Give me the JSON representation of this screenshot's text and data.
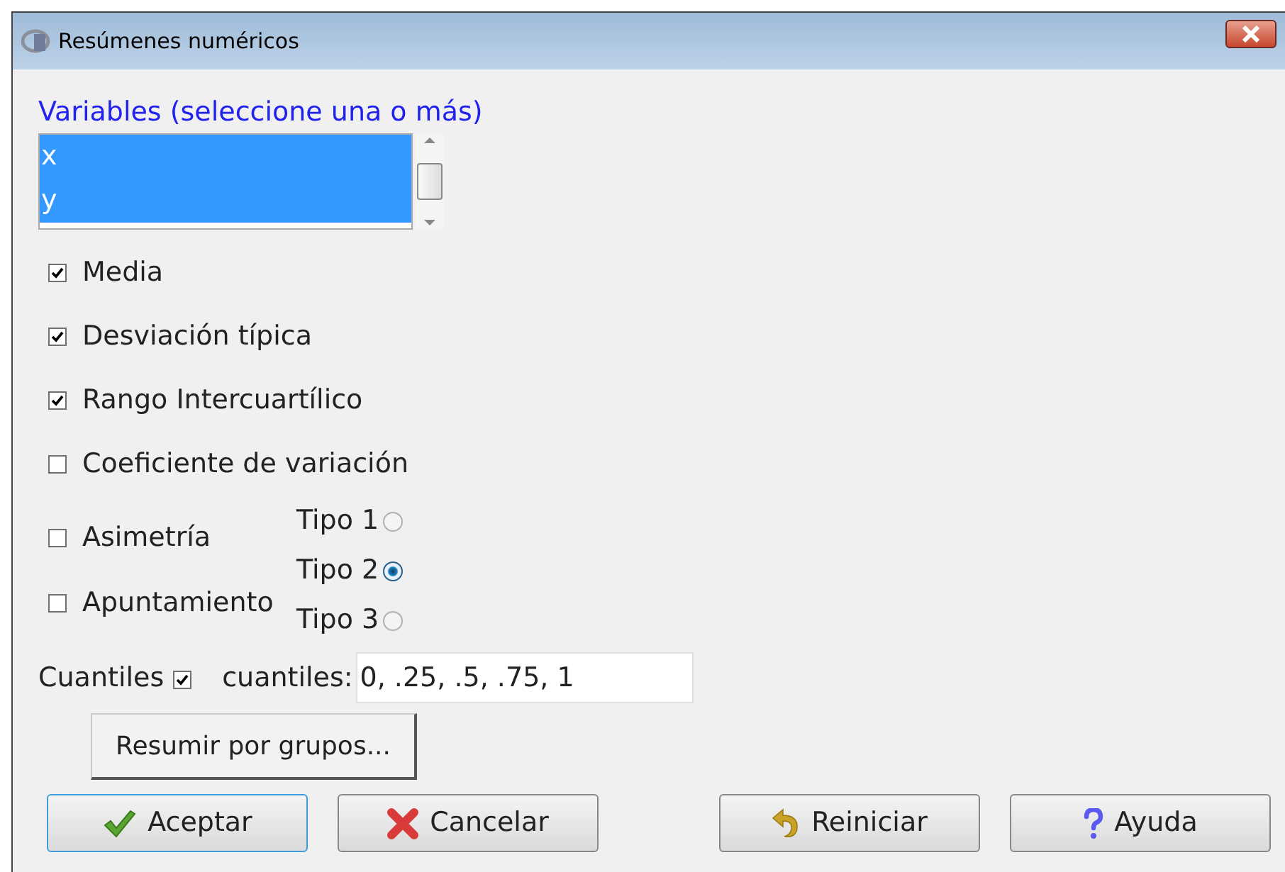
{
  "window": {
    "title": "Resúmenes numéricos"
  },
  "variables": {
    "label": "Variables (seleccione una o más)",
    "items": [
      {
        "text": "x",
        "selected": true
      },
      {
        "text": "y",
        "selected": true
      }
    ]
  },
  "statistics": [
    {
      "label": "Media",
      "checked": true
    },
    {
      "label": "Desviación típica",
      "checked": true
    },
    {
      "label": "Rango Intercuartílico",
      "checked": true
    },
    {
      "label": "Coeficiente de variación",
      "checked": false
    }
  ],
  "shape_statistics": [
    {
      "label": "Asimetría",
      "checked": false
    },
    {
      "label": "Apuntamiento",
      "checked": false
    }
  ],
  "types": [
    {
      "label": "Tipo 1",
      "selected": false
    },
    {
      "label": "Tipo 2",
      "selected": true
    },
    {
      "label": "Tipo 3",
      "selected": false
    }
  ],
  "quantiles": {
    "label": "Cuantiles",
    "checked": true,
    "field_label": "cuantiles:",
    "value": "0, .25, .5, .75, 1"
  },
  "group_button": "Resumir por grupos...",
  "buttons": [
    {
      "kind": "ok",
      "label": "Aceptar",
      "focused": true
    },
    {
      "kind": "cancel",
      "label": "Cancelar",
      "focused": false
    },
    {
      "kind": "reset",
      "label": "Reiniciar",
      "focused": false
    },
    {
      "kind": "help",
      "label": "Ayuda",
      "focused": false
    }
  ]
}
